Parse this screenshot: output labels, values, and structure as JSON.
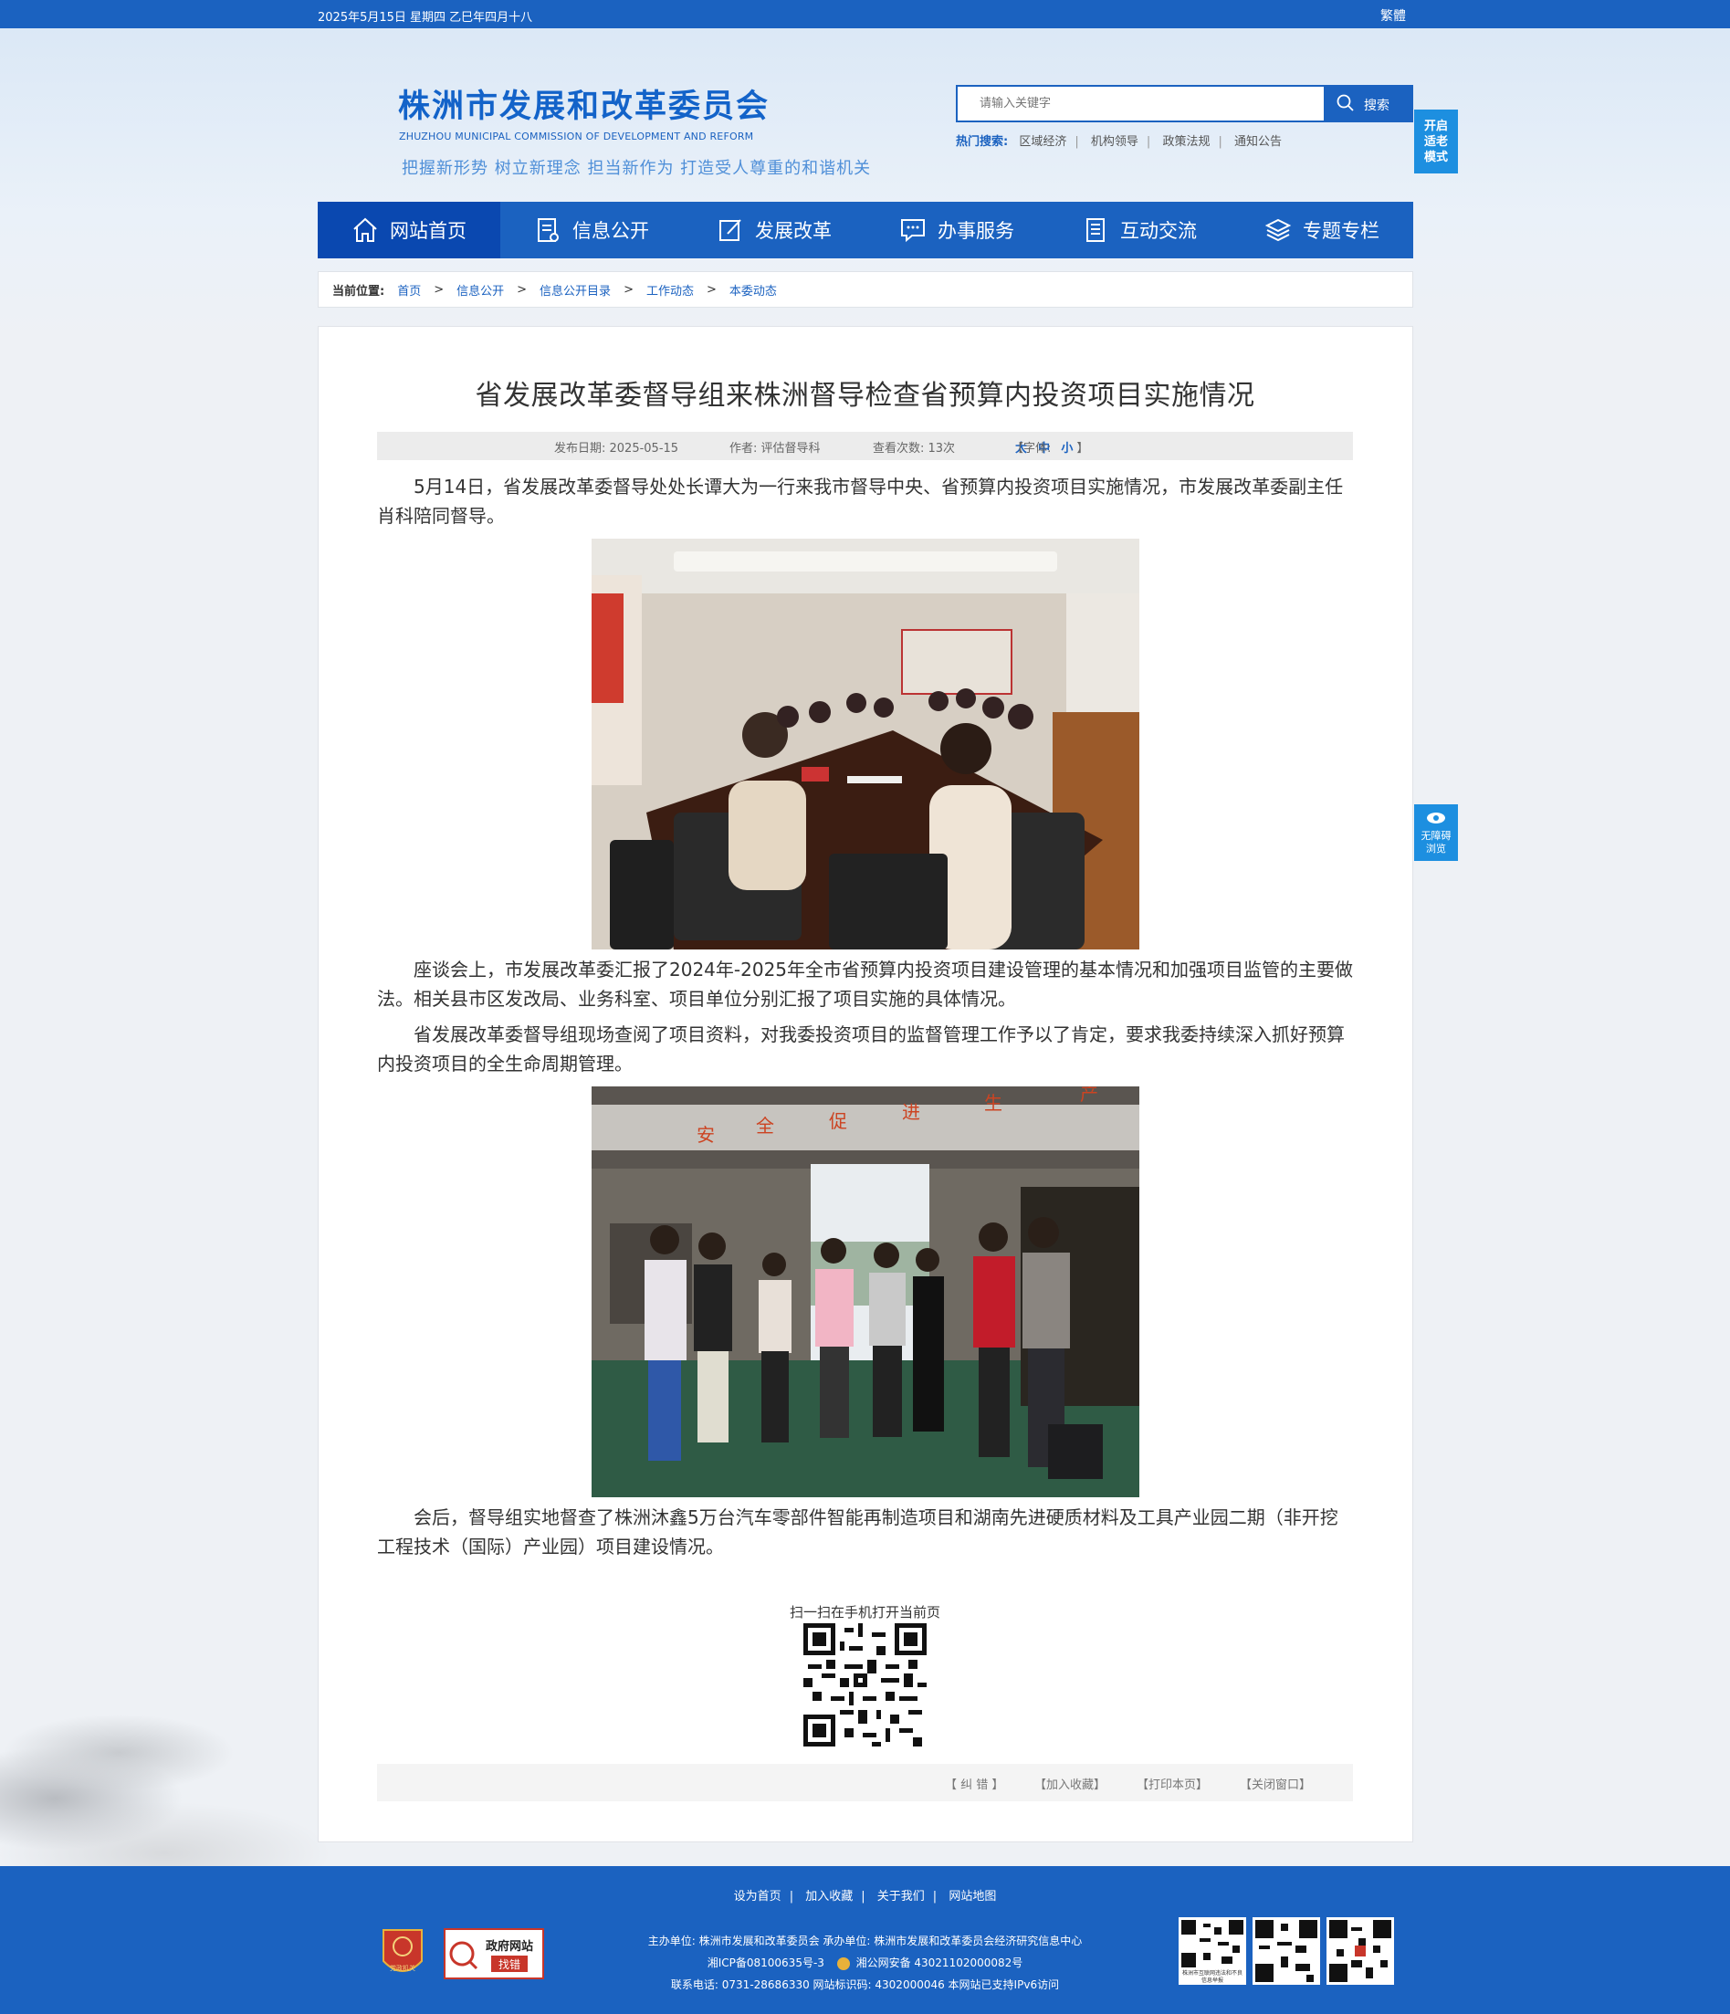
{
  "topbar": {
    "date": "2025年5月15日  星期四  乙巳年四月十八",
    "traditional": "繁體"
  },
  "header": {
    "title": "株洲市发展和改革委员会",
    "title_en": "ZHUZHOU MUNICIPAL COMMISSION OF DEVELOPMENT AND REFORM",
    "slogan": "把握新形势 树立新理念 担当新作为 打造受人尊重的和谐机关",
    "search_placeholder": "请输入关键字",
    "search_button": "搜索",
    "hot_label": "热门搜索:",
    "hot_items": [
      "区域经济",
      "机构领导",
      "政策法规",
      "通知公告"
    ],
    "elder_mode": [
      "开启",
      "适老",
      "模式"
    ],
    "accessible": [
      "无障碍",
      "浏览"
    ]
  },
  "nav": [
    {
      "label": "网站首页",
      "icon": "home-icon"
    },
    {
      "label": "信息公开",
      "icon": "document-icon"
    },
    {
      "label": "发展改革",
      "icon": "edit-icon"
    },
    {
      "label": "办事服务",
      "icon": "chat-icon"
    },
    {
      "label": "互动交流",
      "icon": "file-icon"
    },
    {
      "label": "专题专栏",
      "icon": "layers-icon"
    }
  ],
  "breadcrumb": {
    "label": "当前位置:",
    "items": [
      "首页",
      "信息公开",
      "信息公开目录",
      "工作动态",
      "本委动态"
    ]
  },
  "article": {
    "title": "省发展改革委督导组来株洲督导检查省预算内投资项目实施情况",
    "publish_date": "发布日期:  2025-05-15",
    "author": "作者:  评估督导科",
    "views": "查看次数:  13次",
    "font_label": "【字体:",
    "font_sizes": [
      "大",
      "中",
      "小"
    ],
    "font_end": "】",
    "paragraphs": [
      "5月14日，省发展改革委督导处处长谭大为一行来我市督导中央、省预算内投资项目实施情况，市发展改革委副主任肖科陪同督导。",
      "座谈会上，市发展改革委汇报了2024年-2025年全市省预算内投资项目建设管理的基本情况和加强项目监管的主要做法。相关县市区发改局、业务科室、项目单位分别汇报了项目实施的具体情况。",
      "省发展改革委督导组现场查阅了项目资料，对我委投资项目的监督管理工作予以了肯定，要求我委持续深入抓好预算内投资项目的全生命周期管理。",
      "会后，督导组实地督查了株洲沐鑫5万台汽车零部件智能再制造项目和湖南先进硬质材料及工具产业园二期（非开挖工程技术（国际）产业园）项目建设情况。"
    ],
    "photo2_banner": [
      "安",
      "全",
      "促",
      "进",
      "生",
      "产"
    ],
    "qr_caption": "扫一扫在手机打开当前页",
    "tools": [
      "【 纠 错 】",
      "【加入收藏】",
      "【打印本页】",
      "【关闭窗口】"
    ]
  },
  "footer": {
    "links": [
      "设为首页",
      "加入收藏",
      "关于我们",
      "网站地图"
    ],
    "host": "主办单位:  株洲市发展和改革委员会  承办单位:  株洲市发展和改革委员会经济研究信息中心",
    "icp": "湘ICP备08100635号-3",
    "police": "湘公网安备 43021102000082号",
    "contact": "联系电话:  0731-28686330      网站标识码:  4302000046      本网站已支持IPv6访问",
    "badge1_text": "党政机关",
    "badge2_line1": "政府网站",
    "badge2_line2": "找错",
    "qr1_caption": "株洲市互联网违法和不良信息举报"
  },
  "colors": {
    "brand": "#1b62c0",
    "accent": "#1d8fe0",
    "nav_active": "#0a48b0"
  }
}
